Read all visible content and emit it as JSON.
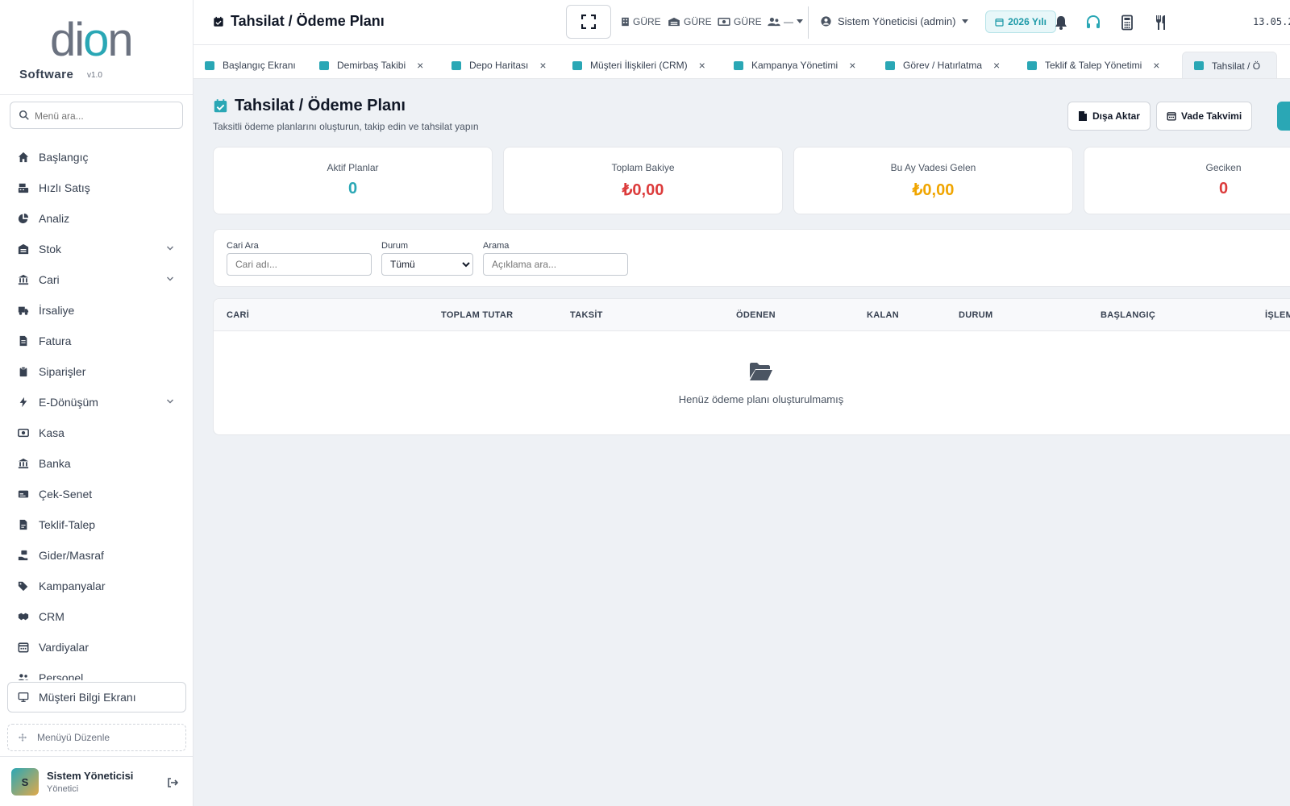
{
  "sidebar": {
    "logo_text": "dion",
    "brand": "Software",
    "version": "v1.0",
    "search_placeholder": "Menü ara...",
    "menu": [
      {
        "label": "Başlangıç",
        "icon": "home-icon",
        "chevron": false
      },
      {
        "label": "Hızlı Satış",
        "icon": "cash-register-icon",
        "chevron": false
      },
      {
        "label": "Analiz",
        "icon": "pie-chart-icon",
        "chevron": false
      },
      {
        "label": "Stok",
        "icon": "warehouse-icon",
        "chevron": true
      },
      {
        "label": "Cari",
        "icon": "bank-icon",
        "chevron": true
      },
      {
        "label": "İrsaliye",
        "icon": "truck-icon",
        "chevron": false
      },
      {
        "label": "Fatura",
        "icon": "invoice-icon",
        "chevron": false
      },
      {
        "label": "Siparişler",
        "icon": "clipboard-icon",
        "chevron": false
      },
      {
        "label": "E-Dönüşüm",
        "icon": "bolt-icon",
        "chevron": true
      },
      {
        "label": "Kasa",
        "icon": "money-icon",
        "chevron": false
      },
      {
        "label": "Banka",
        "icon": "bank-icon",
        "chevron": false
      },
      {
        "label": "Çek-Senet",
        "icon": "card-icon",
        "chevron": false
      },
      {
        "label": "Teklif-Talep",
        "icon": "document-icon",
        "chevron": false
      },
      {
        "label": "Gider/Masraf",
        "icon": "hand-money-icon",
        "chevron": false
      },
      {
        "label": "Kampanyalar",
        "icon": "tags-icon",
        "chevron": false
      },
      {
        "label": "CRM",
        "icon": "handshake-icon",
        "chevron": false
      },
      {
        "label": "Vardiyalar",
        "icon": "calendar-icon",
        "chevron": false
      },
      {
        "label": "Personel",
        "icon": "users-icon",
        "chevron": false
      }
    ],
    "customer_screen_label": "Müşteri Bilgi Ekranı",
    "edit_menu_label": "Menüyü Düzenle",
    "user": {
      "initial": "S",
      "name": "Sistem Yöneticisi",
      "role": "Yönetici"
    }
  },
  "topbar": {
    "title": "Tahsilat / Ödeme Planı",
    "selectors": [
      "GÜRE",
      "GÜRE",
      "GÜRE",
      "—"
    ],
    "user_label": "Sistem Yöneticisi (admin)",
    "year_label": "2026 Yılı",
    "date": "13.05.2"
  },
  "tabs": [
    {
      "label": "Başlangıç Ekranı",
      "closable": false
    },
    {
      "label": "Demirbaş Takibi",
      "closable": true
    },
    {
      "label": "Depo Haritası",
      "closable": true
    },
    {
      "label": "Müşteri İlişkileri (CRM)",
      "closable": true
    },
    {
      "label": "Kampanya Yönetimi",
      "closable": true
    },
    {
      "label": "Görev / Hatırlatma",
      "closable": true
    },
    {
      "label": "Teklif & Talep Yönetimi",
      "closable": true
    },
    {
      "label": "Tahsilat / Ö",
      "closable": false
    }
  ],
  "tab_close_glyph": "×",
  "page": {
    "title": "Tahsilat / Ödeme Planı",
    "subtitle": "Taksitli ödeme planlarını oluşturun, takip edin ve tahsilat yapın",
    "export_label": "Dışa Aktar",
    "calendar_label": "Vade Takvimi"
  },
  "stats": [
    {
      "label": "Aktif Planlar",
      "value": "0",
      "color": "#2aa7b5"
    },
    {
      "label": "Toplam Bakiye",
      "value": "₺0,00",
      "color": "#dc3b3b"
    },
    {
      "label": "Bu Ay Vadesi Gelen",
      "value": "₺0,00",
      "color": "#f0a500"
    },
    {
      "label": "Geciken",
      "value": "0",
      "color": "#dc3b3b"
    }
  ],
  "filters": {
    "cari_label": "Cari Ara",
    "cari_placeholder": "Cari adı...",
    "status_label": "Durum",
    "status_selected": "Tümü",
    "search_label": "Arama",
    "search_placeholder": "Açıklama ara..."
  },
  "table": {
    "columns": [
      "CARİ",
      "TOPLAM TUTAR",
      "TAKSİT",
      "ÖDENEN",
      "KALAN",
      "DURUM",
      "BAŞLANGIÇ",
      "İŞLEM"
    ],
    "empty_text": "Henüz ödeme planı oluşturulmamış"
  },
  "colors": {
    "accent": "#2aa7b5"
  }
}
